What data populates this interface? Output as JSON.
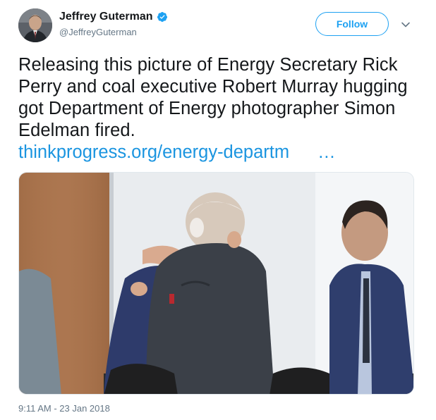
{
  "author": {
    "display_name": "Jeffrey Guterman",
    "handle": "@JeffreyGuterman",
    "verified_icon": "verified-badge-icon"
  },
  "actions": {
    "follow_label": "Follow",
    "menu_icon": "chevron-down-icon"
  },
  "tweet": {
    "text": "Releasing this picture of Energy Secretary Rick Perry and coal executive Robert Murray hugging got Department of Energy photographer Simon Edelman fired.",
    "link_text": "thinkprogress.org/energy-departm",
    "link_ellipsis": "…",
    "timestamp": "9:11 AM - 23 Jan 2018"
  },
  "colors": {
    "accent": "#1da1f2",
    "link": "#1b95e0",
    "text": "#14171a",
    "muted": "#657786"
  }
}
